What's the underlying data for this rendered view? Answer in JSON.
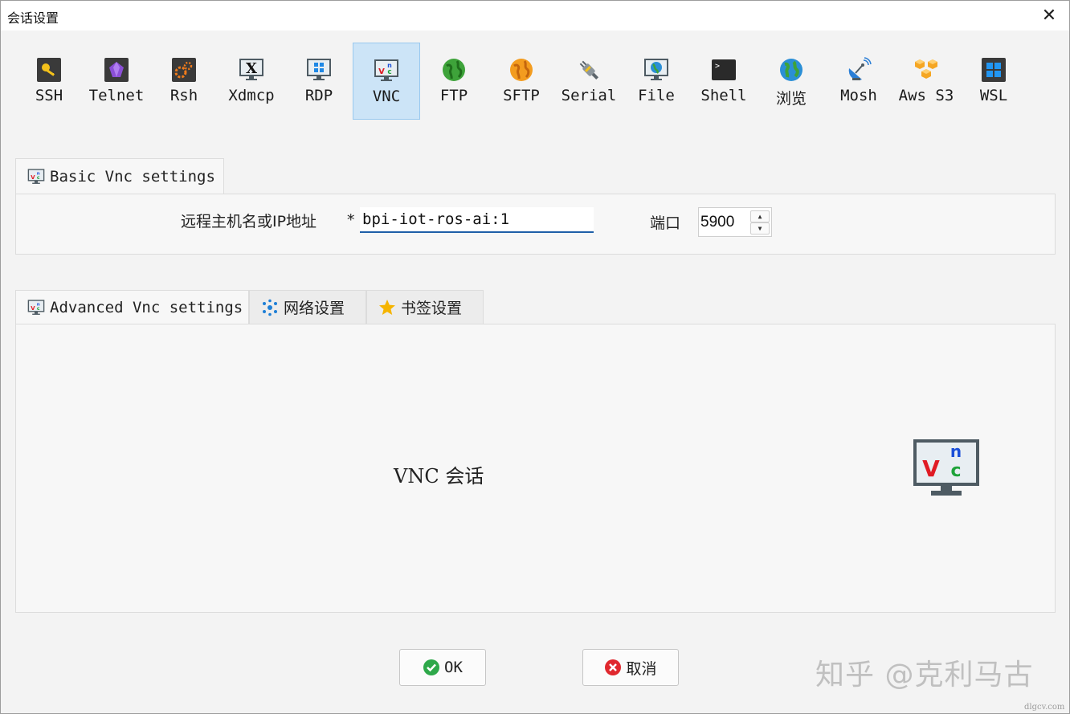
{
  "window": {
    "title": "会话设置",
    "close_glyph": "✕"
  },
  "protocols": [
    {
      "label": "SSH",
      "icon": "key-icon"
    },
    {
      "label": "Telnet",
      "icon": "gem-icon"
    },
    {
      "label": "Rsh",
      "icon": "gears-icon"
    },
    {
      "label": "Xdmcp",
      "icon": "x-monitor-icon"
    },
    {
      "label": "RDP",
      "icon": "windows-monitor-icon"
    },
    {
      "label": "VNC",
      "icon": "vnc-monitor-icon",
      "selected": true
    },
    {
      "label": "FTP",
      "icon": "green-globe-icon"
    },
    {
      "label": "SFTP",
      "icon": "orange-globe-icon"
    },
    {
      "label": "Serial",
      "icon": "plug-icon"
    },
    {
      "label": "File",
      "icon": "globe-monitor-icon"
    },
    {
      "label": "Shell",
      "icon": "terminal-icon"
    },
    {
      "label": "浏览",
      "icon": "earth-icon"
    },
    {
      "label": "Mosh",
      "icon": "satellite-dish-icon"
    },
    {
      "label": "Aws S3",
      "icon": "cubes-icon"
    },
    {
      "label": "WSL",
      "icon": "windows-logo-icon"
    }
  ],
  "basic": {
    "tab_label": "Basic Vnc settings",
    "host_label": "远程主机名或IP地址",
    "required_mark": "*",
    "host_value": "bpi-iot-ros-ai:1",
    "port_label": "端口",
    "port_value": "5900",
    "spin_up": "▲",
    "spin_down": "▼"
  },
  "advanced_tabs": [
    {
      "label": "Advanced Vnc settings",
      "icon": "vnc-monitor-icon"
    },
    {
      "label": "网络设置",
      "icon": "network-icon"
    },
    {
      "label": "书签设置",
      "icon": "star-icon"
    }
  ],
  "content": {
    "session_text": "VNC 会话"
  },
  "buttons": {
    "ok_label": "OK",
    "cancel_label": "取消"
  },
  "watermark": {
    "text": "知乎 @克利马古",
    "site": "dlgcv.com"
  },
  "colors": {
    "selected_bg": "#cce4f7",
    "selected_border": "#99c9ef",
    "input_underline": "#1f5fa8",
    "ok_green": "#2ea84a",
    "cancel_red": "#e0282e",
    "vnc_red": "#e01b24",
    "vnc_blue": "#1b4fd8",
    "vnc_green": "#1fa33a"
  }
}
